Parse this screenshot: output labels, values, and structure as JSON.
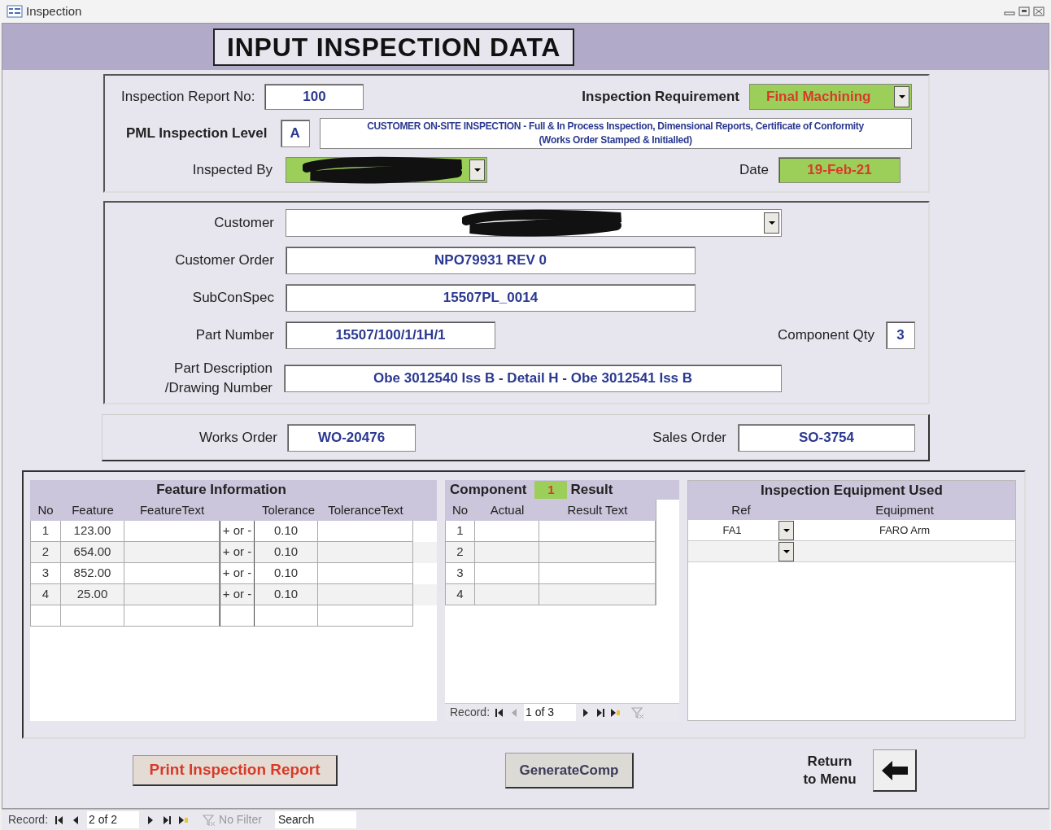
{
  "window": {
    "title": "Inspection"
  },
  "form_title": "INPUT INSPECTION DATA",
  "header_section": {
    "report_no": {
      "label": "Inspection Report No:",
      "value": "100"
    },
    "requirement": {
      "label": "Inspection Requirement",
      "value": "Final Machining"
    },
    "level": {
      "label": "PML Inspection Level",
      "code": "A",
      "description": [
        "CUSTOMER ON-SITE INSPECTION - Full & In Process Inspection, Dimensional Reports, Certificate of Conformity",
        "(Works Order Stamped & Initialled)"
      ]
    },
    "inspected_by": {
      "label": "Inspected By"
    },
    "date": {
      "label": "Date",
      "value": "19-Feb-21"
    }
  },
  "customer_section": {
    "customer": {
      "label": "Customer"
    },
    "customer_order": {
      "label": "Customer Order",
      "value": "NPO79931 REV 0"
    },
    "subconspec": {
      "label": "SubConSpec",
      "value": "15507PL_0014"
    },
    "part_number": {
      "label": "Part Number",
      "value": "15507/100/1/1H/1"
    },
    "component_qty": {
      "label": "Component Qty",
      "value": "3"
    },
    "part_description": {
      "label": [
        "Part Description",
        "/Drawing Number"
      ],
      "value": "Obe 3012540 Iss B - Detail H - Obe 3012541 Iss B"
    }
  },
  "orders": {
    "works_order": {
      "label": "Works Order",
      "value": "WO-20476"
    },
    "sales_order": {
      "label": "Sales Order",
      "value": "SO-3754"
    }
  },
  "feature_table": {
    "title": "Feature Information",
    "columns": [
      "No",
      "Feature",
      "FeatureText",
      "Tolerance",
      "ToleranceText"
    ],
    "rows": [
      {
        "no": "1",
        "feature": "123.00",
        "sign": "+ or -",
        "tolerance": "0.10"
      },
      {
        "no": "2",
        "feature": "654.00",
        "sign": "+ or -",
        "tolerance": "0.10"
      },
      {
        "no": "3",
        "feature": "852.00",
        "sign": "+ or -",
        "tolerance": "0.10"
      },
      {
        "no": "4",
        "feature": "25.00",
        "sign": "+ or -",
        "tolerance": "0.10"
      }
    ]
  },
  "result_table": {
    "title_left": "Component",
    "component_no": "1",
    "title_right": "Result",
    "columns": [
      "No",
      "Actual",
      "Result Text"
    ],
    "rows": [
      {
        "no": "1"
      },
      {
        "no": "2"
      },
      {
        "no": "3"
      },
      {
        "no": "4"
      }
    ],
    "record_nav": {
      "label": "Record:",
      "position": "1 of 3"
    }
  },
  "equipment_table": {
    "title": "Inspection Equipment Used",
    "columns": [
      "Ref",
      "Equipment"
    ],
    "rows": [
      {
        "ref": "FA1",
        "equipment": "FARO Arm"
      }
    ]
  },
  "buttons": {
    "print": "Print Inspection Report",
    "generate": "GenerateComp",
    "return": [
      "Return",
      "to Menu"
    ]
  },
  "status_bar": {
    "label": "Record:",
    "position": "2 of 2",
    "filter": "No Filter",
    "search": "Search"
  }
}
